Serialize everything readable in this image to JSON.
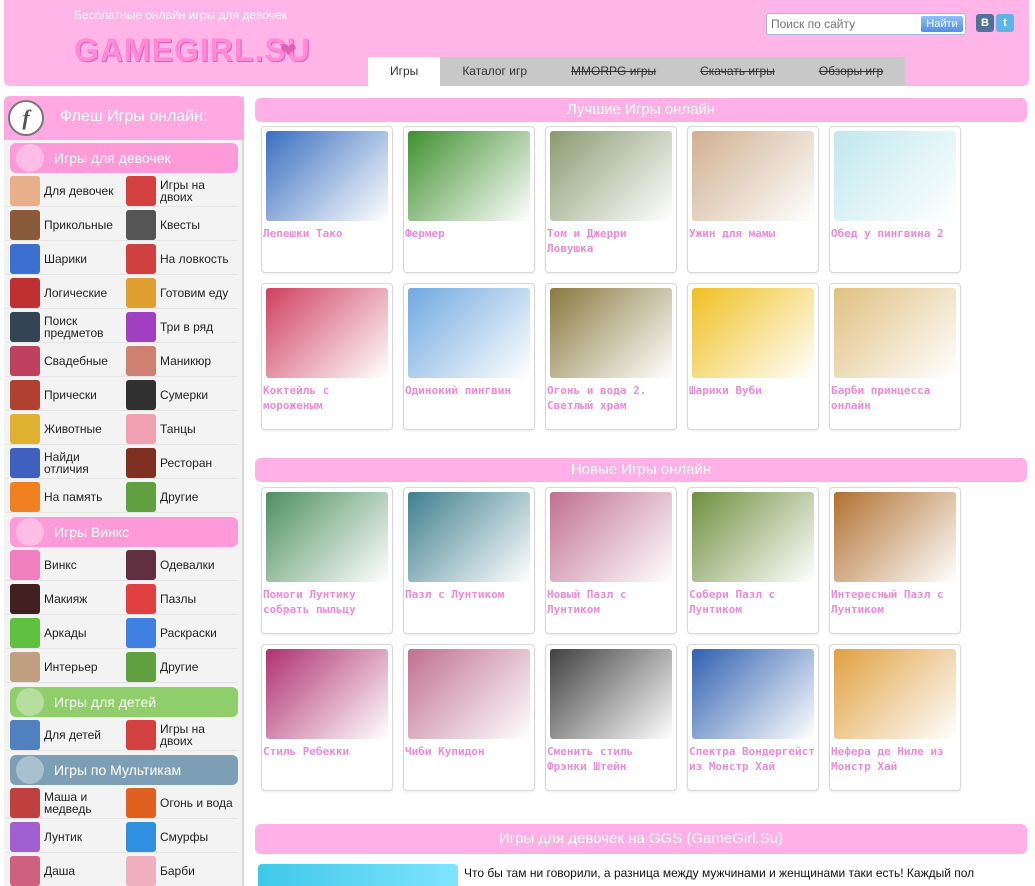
{
  "header": {
    "tagline": "Бесплатные онлайн игры для девочек",
    "logo": "GAMEGIRL.SU",
    "search_placeholder": "Поиск по сайту",
    "search_button": "Найти",
    "social": {
      "vk": "В",
      "twitter": "t"
    }
  },
  "nav": [
    {
      "label": "Игры",
      "active": true,
      "strike": false
    },
    {
      "label": "Каталог игр",
      "active": false,
      "strike": false
    },
    {
      "label": "MMORPG игры",
      "active": false,
      "strike": true
    },
    {
      "label": "Скачать игры",
      "active": false,
      "strike": true
    },
    {
      "label": "Обзоры игр",
      "active": false,
      "strike": true
    }
  ],
  "sidebar": {
    "title": "Флеш Игры онлайн:",
    "flash_icon": "f",
    "sections": [
      {
        "label": "Игры для девочек",
        "color": "#ff9ad8",
        "items": [
          {
            "label": "Для девочек",
            "color": "#e7b08a"
          },
          {
            "label": "Игры на двоих",
            "color": "#d24040"
          },
          {
            "label": "Прикольные",
            "color": "#8a5a3a"
          },
          {
            "label": "Квесты",
            "color": "#555555"
          },
          {
            "label": "Шарики",
            "color": "#3b6fd0"
          },
          {
            "label": "На ловкость",
            "color": "#d04040"
          },
          {
            "label": "Логические",
            "color": "#c03030"
          },
          {
            "label": "Готовим еду",
            "color": "#e0a030"
          },
          {
            "label": "Поиск предметов",
            "color": "#334455"
          },
          {
            "label": "Три в ряд",
            "color": "#a040c0"
          },
          {
            "label": "Свадебные",
            "color": "#c04060"
          },
          {
            "label": "Маникюр",
            "color": "#d08070"
          },
          {
            "label": "Прически",
            "color": "#b04030"
          },
          {
            "label": "Сумерки",
            "color": "#303030"
          },
          {
            "label": "Животные",
            "color": "#e0b030"
          },
          {
            "label": "Танцы",
            "color": "#f0a0b0"
          },
          {
            "label": "Найди отличия",
            "color": "#4060c0"
          },
          {
            "label": "Ресторан",
            "color": "#803020"
          },
          {
            "label": "На память",
            "color": "#f08020"
          },
          {
            "label": "Другие",
            "color": "#60a040"
          }
        ]
      },
      {
        "label": "Игры Винкс",
        "color": "#ff9ad8",
        "items": [
          {
            "label": "Винкс",
            "color": "#f080c0"
          },
          {
            "label": "Одевалки",
            "color": "#603040"
          },
          {
            "label": "Макияж",
            "color": "#402020"
          },
          {
            "label": "Пазлы",
            "color": "#e04040"
          },
          {
            "label": "Аркады",
            "color": "#60c040"
          },
          {
            "label": "Раскраски",
            "color": "#4080e0"
          },
          {
            "label": "Интерьер",
            "color": "#c0a080"
          },
          {
            "label": "Другие",
            "color": "#60a040"
          }
        ]
      },
      {
        "label": "Игры для детей",
        "color": "#8fce6a",
        "items": [
          {
            "label": "Для детей",
            "color": "#5080c0"
          },
          {
            "label": "Игры на двоих",
            "color": "#d24040"
          }
        ]
      },
      {
        "label": "Игры по Мультикам",
        "color": "#7c9fb5",
        "items": [
          {
            "label": "Маша и медведь",
            "color": "#c04040"
          },
          {
            "label": "Огонь и вода",
            "color": "#e06020"
          },
          {
            "label": "Лунтик",
            "color": "#a060d0"
          },
          {
            "label": "Смурфы",
            "color": "#3090e0"
          },
          {
            "label": "Даша",
            "color": "#d06080"
          },
          {
            "label": "Барби",
            "color": "#f0b0c0"
          }
        ]
      }
    ]
  },
  "best": {
    "heading": "Лучшие Игры онлайн",
    "games": [
      {
        "title": "Лепешки Тако",
        "color": "#3a6fc0"
      },
      {
        "title": "Фермер",
        "color": "#3f8f2f"
      },
      {
        "title": "Том и Джерри Ловушка",
        "color": "#8a9a70"
      },
      {
        "title": "Ужин для мамы",
        "color": "#d0b090"
      },
      {
        "title": "Обед у пингвина 2",
        "color": "#bfe8ee"
      },
      {
        "title": "Коктейль с мороженым",
        "color": "#d04060"
      },
      {
        "title": "Одинокий пингвин",
        "color": "#6fa8e0"
      },
      {
        "title": "Огонь и вода 2. Светлый храм",
        "color": "#8a7a40"
      },
      {
        "title": "Шарики Вуби",
        "color": "#f0c020"
      },
      {
        "title": "Барби принцесса онлайн",
        "color": "#e0c080"
      }
    ]
  },
  "new": {
    "heading": "Новые Игры онлайн",
    "games": [
      {
        "title": "Помоги Лунтику собрать пыльцу",
        "color": "#4f8f5f"
      },
      {
        "title": "Пазл с Лунтиком",
        "color": "#3f7f8f"
      },
      {
        "title": "Новый Пазл с Лунтиком",
        "color": "#c07090"
      },
      {
        "title": "Собери Пазл с Лунтиком",
        "color": "#6f8f3f"
      },
      {
        "title": "Интересный Пазл с Лунтиком",
        "color": "#b07030"
      },
      {
        "title": "Стиль Ребекки",
        "color": "#b03070"
      },
      {
        "title": "Чиби Купидон",
        "color": "#c07090"
      },
      {
        "title": "Сменить стиль Фрэнки Штейн",
        "color": "#404040"
      },
      {
        "title": "Спектра Вондергейст из Монстр Хай",
        "color": "#3060b0"
      },
      {
        "title": "Нефера де Ниле из Монстр Хай",
        "color": "#e0a040"
      }
    ]
  },
  "about": {
    "heading": "Игры для девочек на GGS (GameGirl.Su)",
    "text": "Что бы там ни говорили, а разница между мужчинами и женщинами таки есть! Каждый пол"
  }
}
